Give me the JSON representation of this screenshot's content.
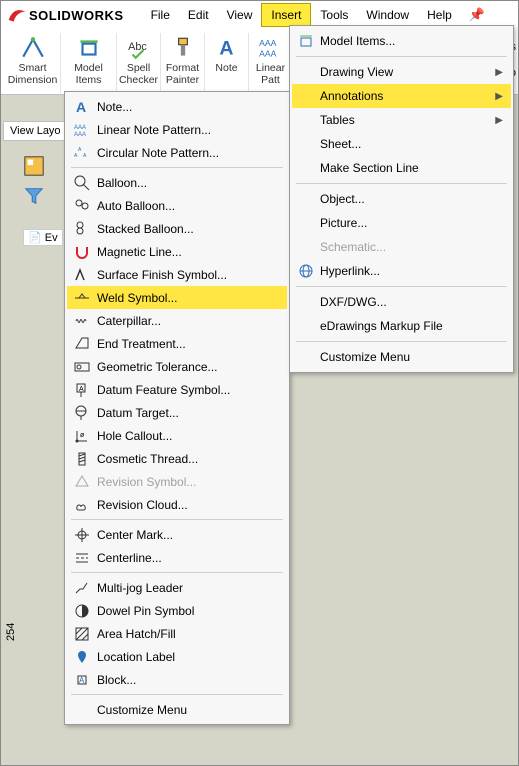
{
  "app": {
    "name": "SOLIDWORKS"
  },
  "menubar": {
    "items": [
      "File",
      "Edit",
      "View",
      "Insert",
      "Tools",
      "Window",
      "Help"
    ],
    "highlighted": "Insert"
  },
  "ribbon": {
    "buttons": [
      {
        "label": "Smart Dimension",
        "icon": "dimension-icon"
      },
      {
        "label": "Model Items",
        "icon": "model-items-icon"
      },
      {
        "label": "Spell Checker",
        "icon": "spell-icon"
      },
      {
        "label": "Format Painter",
        "icon": "format-painter-icon"
      },
      {
        "label": "Note",
        "icon": "note-icon"
      },
      {
        "label": "Linear Patt",
        "icon": "linear-pattern-icon"
      }
    ],
    "right_cutoff": "nis",
    "right_cutoff2": "mbo"
  },
  "view_layout_label": "View Layo",
  "side_number": "254",
  "insert_menu": {
    "model_items": "Model Items...",
    "drawing_view": "Drawing View",
    "annotations": "Annotations",
    "tables": "Tables",
    "sheet": "Sheet...",
    "make_section": "Make Section Line",
    "object": "Object...",
    "picture": "Picture...",
    "schematic": "Schematic...",
    "hyperlink": "Hyperlink...",
    "dxf": "DXF/DWG...",
    "edrawings": "eDrawings Markup File",
    "customize": "Customize Menu"
  },
  "anno_menu": {
    "note": "Note...",
    "linear_note": "Linear Note Pattern...",
    "circular_note": "Circular Note Pattern...",
    "balloon": "Balloon...",
    "auto_balloon": "Auto Balloon...",
    "stacked_balloon": "Stacked Balloon...",
    "magnetic_line": "Magnetic Line...",
    "surface_finish": "Surface Finish Symbol...",
    "weld_symbol": "Weld Symbol...",
    "caterpillar": "Caterpillar...",
    "end_treatment": "End Treatment...",
    "geo_tol": "Geometric Tolerance...",
    "datum_feature": "Datum Feature Symbol...",
    "datum_target": "Datum Target...",
    "hole_callout": "Hole Callout...",
    "cosmetic_thread": "Cosmetic Thread...",
    "revision_symbol": "Revision Symbol...",
    "revision_cloud": "Revision Cloud...",
    "center_mark": "Center Mark...",
    "centerline": "Centerline...",
    "multijog": "Multi-jog Leader",
    "dowel_pin": "Dowel Pin Symbol",
    "area_hatch": "Area Hatch/Fill",
    "location_label": "Location Label",
    "block": "Block...",
    "customize": "Customize Menu"
  },
  "tree_root": "Ev"
}
